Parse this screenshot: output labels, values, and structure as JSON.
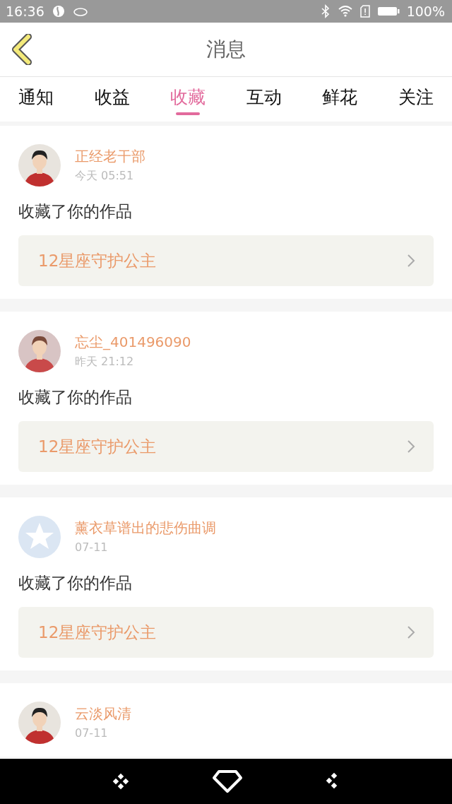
{
  "status_bar": {
    "time": "16:36",
    "battery": "100%"
  },
  "header": {
    "title": "消息"
  },
  "tabs": [
    {
      "label": "通知",
      "selected": false
    },
    {
      "label": "收益",
      "selected": false
    },
    {
      "label": "收藏",
      "selected": true
    },
    {
      "label": "互动",
      "selected": false
    },
    {
      "label": "鲜花",
      "selected": false
    },
    {
      "label": "关注",
      "selected": false
    }
  ],
  "items": [
    {
      "user": "正经老干部",
      "time": "今天 05:51",
      "action": "收藏了你的作品",
      "work": "12星座守护公主"
    },
    {
      "user": "忘尘_401496090",
      "time": "昨天 21:12",
      "action": "收藏了你的作品",
      "work": "12星座守护公主"
    },
    {
      "user": "薰衣草谱出的悲伤曲调",
      "time": "07-11",
      "avatar": {
        "kind": "icon"
      },
      "action": "收藏了你的作品",
      "work": "12星座守护公主"
    },
    {
      "user": "云淡风清",
      "time": "07-11"
    }
  ]
}
